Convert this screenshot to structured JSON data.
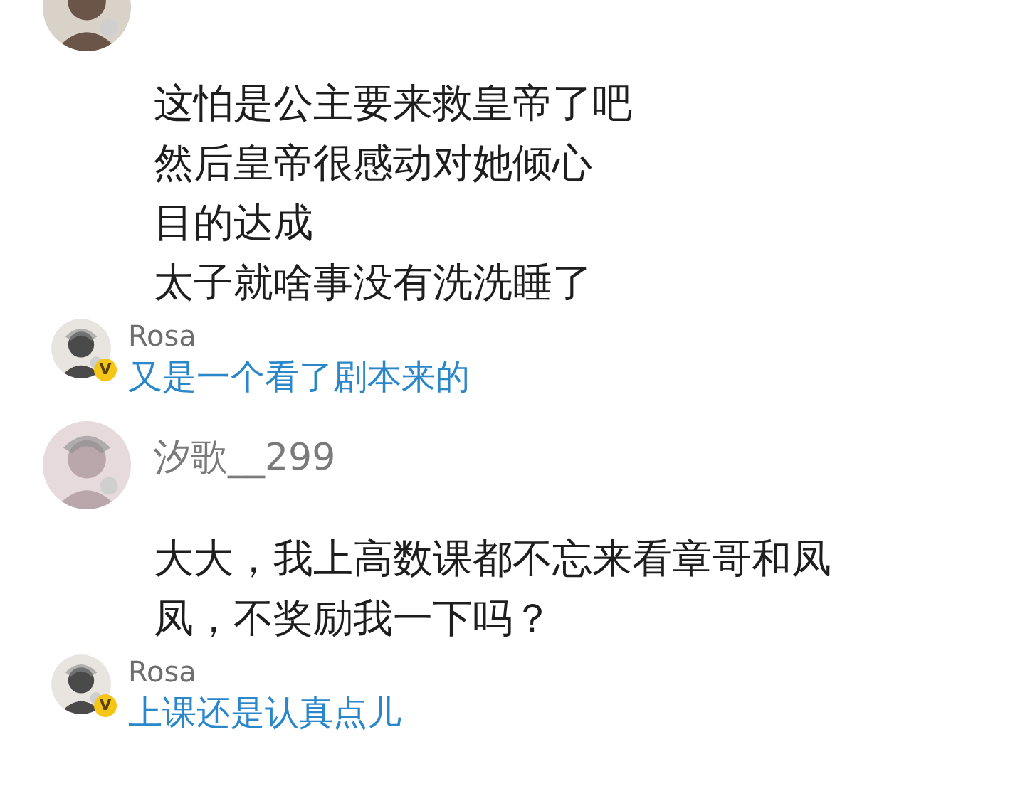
{
  "comments": [
    {
      "lines": [
        "这怕是公主要来救皇帝了吧",
        "然后皇帝很感动对她倾心",
        "目的达成",
        "太子就啥事没有洗洗睡了"
      ],
      "replies": [
        {
          "user": "Rosa",
          "badge": "V",
          "text": "又是一个看了剧本来的"
        }
      ]
    },
    {
      "user": "汐歌__299",
      "lines": [
        "大大，我上高数课都不忘来看章哥和凤",
        "凤，不奖励我一下吗？"
      ],
      "replies": [
        {
          "user": "Rosa",
          "badge": "V",
          "text": "上课还是认真点儿"
        }
      ]
    }
  ]
}
